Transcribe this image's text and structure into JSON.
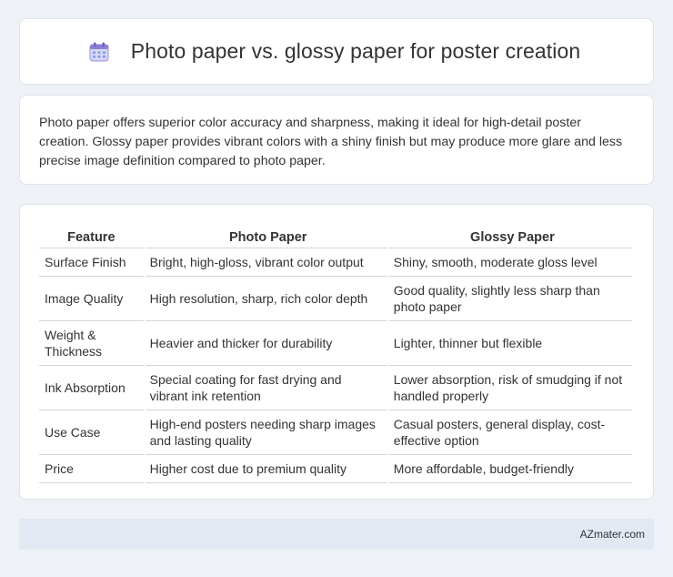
{
  "header": {
    "icon": "calendar-icon",
    "title": "Photo paper vs. glossy paper for poster creation"
  },
  "intro": {
    "text": "Photo paper offers superior color accuracy and sharpness, making it ideal for high-detail poster creation. Glossy paper provides vibrant colors with a shiny finish but may produce more glare and less precise image definition compared to photo paper."
  },
  "table": {
    "headers": [
      "Feature",
      "Photo Paper",
      "Glossy Paper"
    ],
    "rows": [
      [
        "Surface Finish",
        "Bright, high-gloss, vibrant color output",
        "Shiny, smooth, moderate gloss level"
      ],
      [
        "Image Quality",
        "High resolution, sharp, rich color depth",
        "Good quality, slightly less sharp than photo paper"
      ],
      [
        "Weight & Thickness",
        "Heavier and thicker for durability",
        "Lighter, thinner but flexible"
      ],
      [
        "Ink Absorption",
        "Special coating for fast drying and vibrant ink retention",
        "Lower absorption, risk of smudging if not handled properly"
      ],
      [
        "Use Case",
        "High-end posters needing sharp images and lasting quality",
        "Casual posters, general display, cost-effective option"
      ],
      [
        "Price",
        "Higher cost due to premium quality",
        "More affordable, budget-friendly"
      ]
    ]
  },
  "footer": {
    "text": "AZmater.com"
  },
  "colors": {
    "background": "#eef2f7",
    "card": "#ffffff",
    "footer": "#e3e9f3",
    "icon_purple": "#8b7fd6",
    "icon_blue": "#5b9bf0"
  }
}
